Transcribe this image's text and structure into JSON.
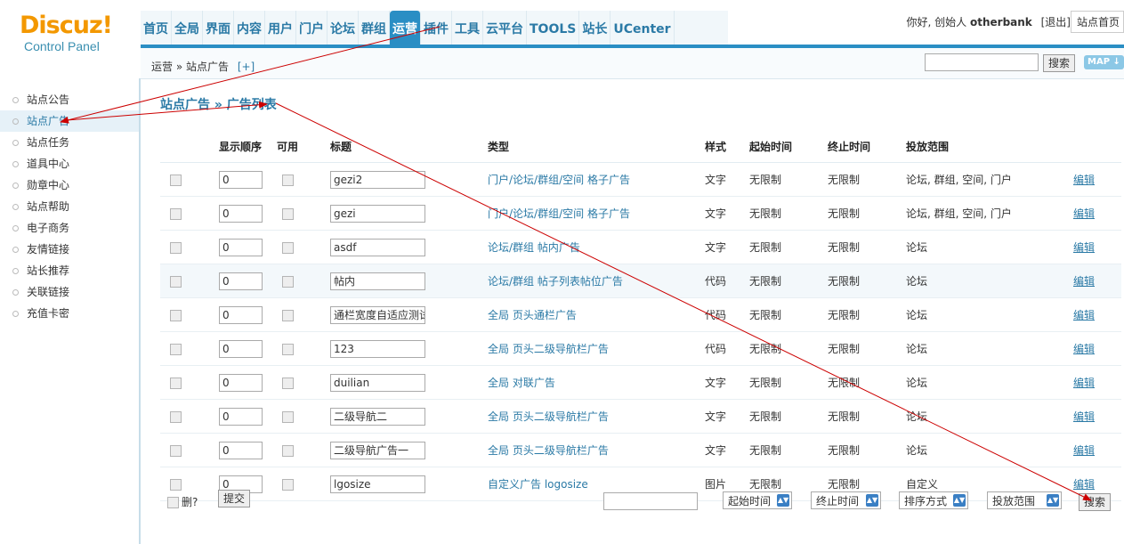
{
  "header": {
    "logo_brand": "Discuz!",
    "logo_sub": "Control Panel",
    "nav": [
      "首页",
      "全局",
      "界面",
      "内容",
      "用户",
      "门户",
      "论坛",
      "群组",
      "运营",
      "插件",
      "工具",
      "云平台",
      "TOOLS",
      "站长",
      "UCenter"
    ],
    "active_nav": "运营",
    "greeting": "你好, 创始人",
    "username": "otherbank",
    "logout": "[退出]",
    "site_home": "站点首页"
  },
  "subhead": {
    "breadcrumb": "运营 » 站点广告",
    "add": "[+]",
    "search_button": "搜索",
    "map_button": "MAP ↓"
  },
  "sidebar": {
    "items": [
      "站点公告",
      "站点广告",
      "站点任务",
      "道具中心",
      "勋章中心",
      "站点帮助",
      "电子商务",
      "友情链接",
      "站长推荐",
      "关联链接",
      "充值卡密"
    ],
    "active": "站点广告"
  },
  "main": {
    "title": "站点广告 » 广告列表",
    "columns": [
      "",
      "显示顺序",
      "可用",
      "标题",
      "类型",
      "样式",
      "起始时间",
      "终止时间",
      "投放范围",
      ""
    ],
    "rows": [
      {
        "order": "0",
        "title": "gezi2",
        "type": "门户/论坛/群组/空间 格子广告",
        "style": "文字",
        "start": "无限制",
        "end": "无限制",
        "scope": "论坛, 群组, 空间, 门户",
        "edit": "编辑"
      },
      {
        "order": "0",
        "title": "gezi",
        "type": "门户/论坛/群组/空间 格子广告",
        "style": "文字",
        "start": "无限制",
        "end": "无限制",
        "scope": "论坛, 群组, 空间, 门户",
        "edit": "编辑"
      },
      {
        "order": "0",
        "title": "asdf",
        "type": "论坛/群组 帖内广告",
        "style": "文字",
        "start": "无限制",
        "end": "无限制",
        "scope": "论坛",
        "edit": "编辑"
      },
      {
        "order": "0",
        "title": "帖内",
        "type": "论坛/群组 帖子列表帖位广告",
        "style": "代码",
        "start": "无限制",
        "end": "无限制",
        "scope": "论坛",
        "edit": "编辑"
      },
      {
        "order": "0",
        "title": "通栏宽度自适应测试",
        "type": "全局 页头通栏广告",
        "style": "代码",
        "start": "无限制",
        "end": "无限制",
        "scope": "论坛",
        "edit": "编辑"
      },
      {
        "order": "0",
        "title": "123",
        "type": "全局 页头二级导航栏广告",
        "style": "代码",
        "start": "无限制",
        "end": "无限制",
        "scope": "论坛",
        "edit": "编辑"
      },
      {
        "order": "0",
        "title": "duilian",
        "type": "全局 对联广告",
        "style": "文字",
        "start": "无限制",
        "end": "无限制",
        "scope": "论坛",
        "edit": "编辑"
      },
      {
        "order": "0",
        "title": "二级导航二",
        "type": "全局 页头二级导航栏广告",
        "style": "文字",
        "start": "无限制",
        "end": "无限制",
        "scope": "论坛",
        "edit": "编辑"
      },
      {
        "order": "0",
        "title": "二级导航广告一",
        "type": "全局 页头二级导航栏广告",
        "style": "文字",
        "start": "无限制",
        "end": "无限制",
        "scope": "论坛",
        "edit": "编辑"
      },
      {
        "order": "0",
        "title": "lgosize",
        "type": "自定义广告 logosize",
        "style": "图片",
        "start": "无限制",
        "end": "无限制",
        "scope": "自定义",
        "edit": "编辑"
      }
    ],
    "delete_label": "删?",
    "submit": "提交",
    "filters": [
      "起始时间",
      "终止时间",
      "排序方式",
      "投放范围"
    ],
    "search": "搜索"
  },
  "colors": {
    "accent": "#2a8ec4",
    "link": "#2b7aa6",
    "logo": "#f39800",
    "arrow": "#cc0000"
  }
}
